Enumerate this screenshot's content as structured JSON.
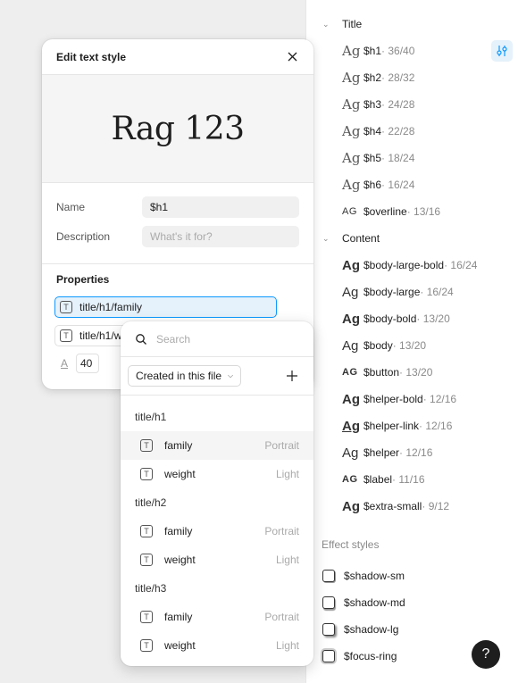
{
  "right_panel": {
    "groups": [
      {
        "title": "Title",
        "items": [
          {
            "name": "$h1",
            "meta": " · 36/40",
            "ag": "Ag"
          },
          {
            "name": "$h2",
            "meta": " · 28/32",
            "ag": "Ag"
          },
          {
            "name": "$h3",
            "meta": " · 24/28",
            "ag": "Ag"
          },
          {
            "name": "$h4",
            "meta": " · 22/28",
            "ag": "Ag"
          },
          {
            "name": "$h5",
            "meta": " · 18/24",
            "ag": "Ag"
          },
          {
            "name": "$h6",
            "meta": " · 16/24",
            "ag": "Ag"
          },
          {
            "name": "$overline",
            "meta": " · 13/16",
            "ag": "AG"
          }
        ]
      },
      {
        "title": "Content",
        "items": [
          {
            "name": "$body-large-bold",
            "meta": " · 16/24",
            "ag": "Ag"
          },
          {
            "name": "$body-large",
            "meta": " · 16/24",
            "ag": "Ag"
          },
          {
            "name": "$body-bold",
            "meta": " · 13/20",
            "ag": "Ag"
          },
          {
            "name": "$body",
            "meta": " · 13/20",
            "ag": "Ag"
          },
          {
            "name": "$button",
            "meta": " · 13/20",
            "ag": "AG"
          },
          {
            "name": "$helper-bold",
            "meta": " · 12/16",
            "ag": "Ag"
          },
          {
            "name": "$helper-link",
            "meta": " · 12/16",
            "ag": "Ag"
          },
          {
            "name": "$helper",
            "meta": " · 12/16",
            "ag": "Ag"
          },
          {
            "name": "$label",
            "meta": " · 11/16",
            "ag": "AG"
          },
          {
            "name": "$extra-small",
            "meta": " · 9/12",
            "ag": "Ag"
          }
        ]
      }
    ],
    "effects_label": "Effect styles",
    "effects": [
      "$shadow-sm",
      "$shadow-md",
      "$shadow-lg",
      "$focus-ring"
    ],
    "help_label": "?"
  },
  "dialog": {
    "title": "Edit text style",
    "preview_text": "Rag 123",
    "name_label": "Name",
    "name_value": "$h1",
    "description_label": "Description",
    "description_placeholder": "What's it for?",
    "properties_label": "Properties",
    "var_family": "title/h1/family",
    "var_weight": "title/h1/w",
    "size_icon": "A",
    "size_value": "40"
  },
  "dropdown": {
    "search_placeholder": "Search",
    "filter_label": "Created in this file",
    "groups": [
      {
        "title": "title/h1",
        "items": [
          {
            "name": "family",
            "value": "Portrait"
          },
          {
            "name": "weight",
            "value": "Light"
          }
        ]
      },
      {
        "title": "title/h2",
        "items": [
          {
            "name": "family",
            "value": "Portrait"
          },
          {
            "name": "weight",
            "value": "Light"
          }
        ]
      },
      {
        "title": "title/h3",
        "items": [
          {
            "name": "family",
            "value": "Portrait"
          },
          {
            "name": "weight",
            "value": "Light"
          }
        ]
      }
    ]
  },
  "colors": {
    "accent": "#0d99ff",
    "accent_bg": "#e5f1fb",
    "canvas": "#eeeeee"
  }
}
